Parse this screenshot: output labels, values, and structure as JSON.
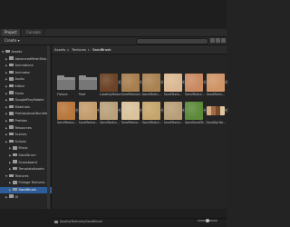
{
  "tabs": {
    "project": "Project",
    "console": "Console"
  },
  "toolbar": {
    "create_label": "Create ▾",
    "search_placeholder": ""
  },
  "tree": [
    {
      "label": "Assets",
      "level": 0,
      "expanded": true
    },
    {
      "label": "AdvancedMeshSkip",
      "level": 1
    },
    {
      "label": "Animations",
      "level": 1
    },
    {
      "label": "Animator",
      "level": 1
    },
    {
      "label": "Audio",
      "level": 1
    },
    {
      "label": "Editor",
      "level": 1
    },
    {
      "label": "Fonts",
      "level": 1
    },
    {
      "label": "GooglePlayMobile",
      "level": 1
    },
    {
      "label": "Materials",
      "level": 1
    },
    {
      "label": "PrefabsAssetBundles",
      "level": 1
    },
    {
      "label": "Prefabs",
      "level": 1
    },
    {
      "label": "Resources",
      "level": 1
    },
    {
      "label": "Scenes",
      "level": 1
    },
    {
      "label": "Scripts",
      "level": 1
    },
    {
      "label": "Music",
      "level": 2
    },
    {
      "label": "SandDrum",
      "level": 2
    },
    {
      "label": "Scoreboard",
      "level": 2
    },
    {
      "label": "TemplateAssets",
      "level": 2
    },
    {
      "label": "Textures",
      "level": 1,
      "expanded": true
    },
    {
      "label": "Foliage Textures",
      "level": 2
    },
    {
      "label": "SandBrush",
      "level": 2,
      "selected": true
    },
    {
      "label": "UI",
      "level": 1
    }
  ],
  "breadcrumb": [
    "Assets",
    "Textures",
    "SandBrush"
  ],
  "assets_row1": [
    {
      "label": "Fixture",
      "kind": "folder"
    },
    {
      "label": "Pixel",
      "kind": "folder"
    },
    {
      "label": "LoadingTextur...",
      "kind": "texture",
      "color": "#6b4326"
    },
    {
      "label": "SandTexture...",
      "kind": "texture",
      "color": "#a77e4f"
    },
    {
      "label": "SandTextu...",
      "kind": "texture",
      "color": "#a98253"
    },
    {
      "label": "SandTextu...",
      "kind": "texture",
      "color": "#dbb893"
    },
    {
      "label": "SandTextur...",
      "kind": "texture",
      "color": "#c98a62"
    },
    {
      "label": "SandTextu...",
      "kind": "texture",
      "color": "#cf9467"
    }
  ],
  "assets_row2": [
    {
      "label": "SandTextur...",
      "kind": "texture",
      "color": "#b8773c"
    },
    {
      "label": "SandTextur...",
      "kind": "texture",
      "color": "#c39c6d"
    },
    {
      "label": "SandTextur...",
      "kind": "texture",
      "color": "#b9a07b"
    },
    {
      "label": "SandTextur...",
      "kind": "texture",
      "color": "#d9c29c"
    },
    {
      "label": "SandTextur...",
      "kind": "texture",
      "color": "#c5a56b"
    },
    {
      "label": "SandTextur...",
      "kind": "texture",
      "color": "#b89f78"
    },
    {
      "label": "SandSandTe...",
      "kind": "texture",
      "color": "#5c8a3a"
    },
    {
      "label": "SandSprite...",
      "kind": "palette",
      "color": "#a87750"
    }
  ],
  "status": {
    "path": "Assets/Textures/SandBrush"
  },
  "colors": {
    "selection": "#2f5d99",
    "panel_bg": "#242424"
  }
}
